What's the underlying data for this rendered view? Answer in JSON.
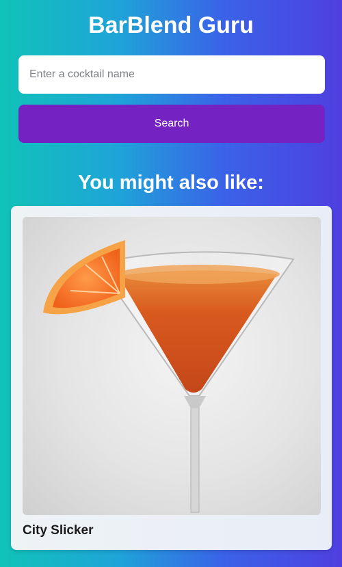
{
  "app": {
    "title": "BarBlend Guru"
  },
  "search": {
    "placeholder": "Enter a cocktail name",
    "value": "",
    "button_label": "Search"
  },
  "suggestions": {
    "heading": "You might also like:",
    "items": [
      {
        "name": "City Slicker",
        "image_icon": "cocktail-martini-glass-orange-garnish"
      }
    ]
  },
  "colors": {
    "button": "#7522c2",
    "gradient_start": "#10c3b8",
    "gradient_end": "#4f3fe0"
  }
}
